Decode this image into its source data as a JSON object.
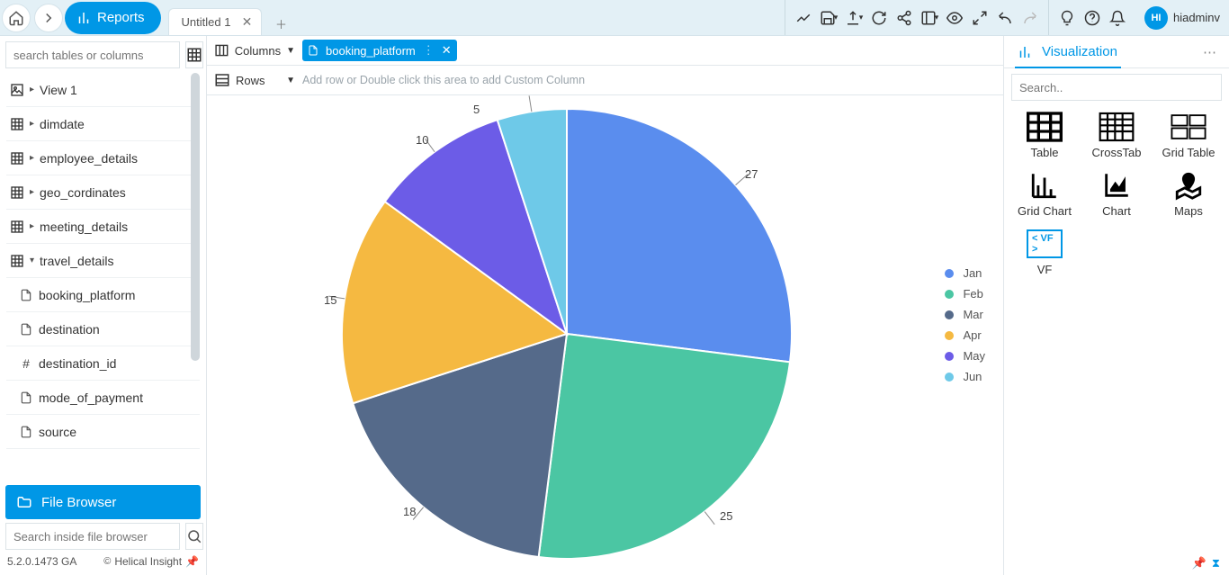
{
  "header": {
    "reports_label": "Reports",
    "tab_title": "Untitled 1",
    "username": "hiadminv",
    "avatar_initials": "HI"
  },
  "sidebar": {
    "search_placeholder": "search tables or columns",
    "items": [
      {
        "icon": "view",
        "label": "View 1",
        "caret": "▸"
      },
      {
        "icon": "grid",
        "label": "dimdate",
        "caret": "▸"
      },
      {
        "icon": "grid",
        "label": "employee_details",
        "caret": "▸"
      },
      {
        "icon": "grid",
        "label": "geo_cordinates",
        "caret": "▸"
      },
      {
        "icon": "grid",
        "label": "meeting_details",
        "caret": "▸"
      },
      {
        "icon": "grid",
        "label": "travel_details",
        "caret": "▾"
      },
      {
        "icon": "sheet",
        "label": "booking_platform",
        "child": true
      },
      {
        "icon": "sheet",
        "label": "destination",
        "child": true
      },
      {
        "icon": "hash",
        "label": "destination_id",
        "child": true
      },
      {
        "icon": "sheet",
        "label": "mode_of_payment",
        "child": true
      },
      {
        "icon": "sheet",
        "label": "source",
        "child": true
      }
    ],
    "file_browser_label": "File Browser",
    "file_search_placeholder": "Search inside file browser",
    "version": "5.2.0.1473 GA",
    "brand": "Helical Insight"
  },
  "shelves": {
    "columns_label": "Columns",
    "rows_label": "Rows",
    "rows_placeholder": "Add row or Double click this area to add Custom Column",
    "column_pill": "booking_platform"
  },
  "vis_panel": {
    "title": "Visualization",
    "search_placeholder": "Search..",
    "types": [
      "Table",
      "CrossTab",
      "Grid Table",
      "Grid Chart",
      "Chart",
      "Maps",
      "VF"
    ]
  },
  "chart_data": {
    "type": "pie",
    "series": [
      {
        "name": "Jan",
        "value": 27,
        "color": "#5a8dee"
      },
      {
        "name": "Feb",
        "value": 25,
        "color": "#4bc6a3"
      },
      {
        "name": "Mar",
        "value": 18,
        "color": "#556a8a"
      },
      {
        "name": "Apr",
        "value": 15,
        "color": "#f5b941"
      },
      {
        "name": "May",
        "value": 10,
        "color": "#6c5ce7"
      },
      {
        "name": "Jun",
        "value": 5,
        "color": "#6ec9e8"
      }
    ]
  }
}
